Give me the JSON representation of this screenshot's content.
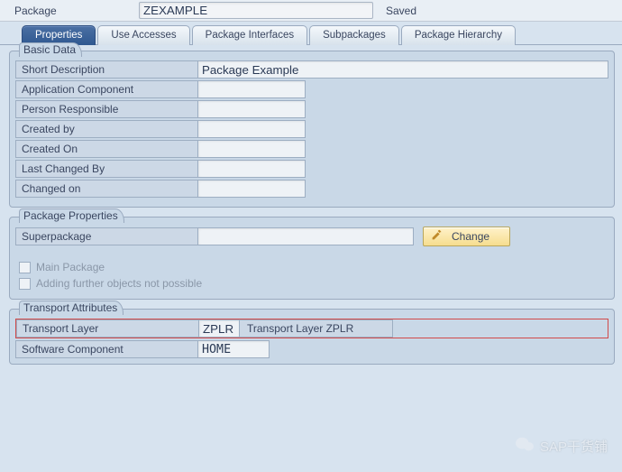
{
  "header": {
    "package_label": "Package",
    "package_value": "ZEXAMPLE",
    "status": "Saved"
  },
  "tabs": [
    {
      "label": "Properties",
      "active": true
    },
    {
      "label": "Use Accesses",
      "active": false
    },
    {
      "label": "Package Interfaces",
      "active": false
    },
    {
      "label": "Subpackages",
      "active": false
    },
    {
      "label": "Package Hierarchy",
      "active": false
    }
  ],
  "basic_data": {
    "title": "Basic Data",
    "rows": {
      "short_desc_label": "Short Description",
      "short_desc_value": "Package Example",
      "app_comp_label": "Application Component",
      "app_comp_value": "",
      "person_resp_label": "Person Responsible",
      "person_resp_value": "",
      "created_by_label": "Created by",
      "created_by_value": "",
      "created_on_label": "Created On",
      "created_on_value": "",
      "last_changed_by_label": "Last Changed By",
      "last_changed_by_value": "",
      "changed_on_label": "Changed on",
      "changed_on_value": ""
    }
  },
  "package_props": {
    "title": "Package Properties",
    "superpackage_label": "Superpackage",
    "superpackage_value": "",
    "change_button": "Change",
    "main_package_label": "Main Package",
    "main_package_checked": false,
    "adding_label": "Adding further objects not possible",
    "adding_checked": false
  },
  "transport": {
    "title": "Transport Attributes",
    "layer_label": "Transport Layer",
    "layer_code": "ZPLR",
    "layer_desc": "Transport Layer ZPLR",
    "sw_comp_label": "Software Component",
    "sw_comp_value": "HOME"
  },
  "watermark": "SAP干货铺"
}
